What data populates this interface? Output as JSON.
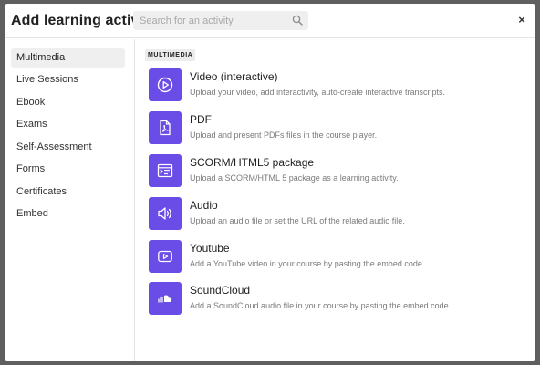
{
  "header": {
    "title": "Add learning activity",
    "search_placeholder": "Search for an activity",
    "close_label": "×"
  },
  "sidebar": {
    "items": [
      {
        "label": "Multimedia",
        "active": true
      },
      {
        "label": "Live Sessions"
      },
      {
        "label": "Ebook"
      },
      {
        "label": "Exams"
      },
      {
        "label": "Self-Assessment"
      },
      {
        "label": "Forms"
      },
      {
        "label": "Certificates"
      },
      {
        "label": "Embed"
      }
    ]
  },
  "content": {
    "section_label": "MULTIMEDIA",
    "accent_color": "#6a4ce6",
    "activities": [
      {
        "name": "Video (interactive)",
        "icon": "play-circle-icon",
        "description": "Upload your video, add interactivity, auto-create interactive transcripts."
      },
      {
        "name": "PDF",
        "icon": "pdf-file-icon",
        "description": "Upload and present PDFs files in the course player."
      },
      {
        "name": "SCORM/HTML5 package",
        "icon": "scorm-package-icon",
        "description": "Upload a SCORM/HTML 5 package as a learning activity."
      },
      {
        "name": "Audio",
        "icon": "speaker-icon",
        "description": "Upload an audio file or set the URL of the related audio file."
      },
      {
        "name": "Youtube",
        "icon": "youtube-icon",
        "description": "Add a YouTube video in your course by pasting the embed code."
      },
      {
        "name": "SoundCloud",
        "icon": "soundcloud-icon",
        "description": "Add a SoundCloud audio file in your course by pasting the embed code."
      }
    ]
  }
}
